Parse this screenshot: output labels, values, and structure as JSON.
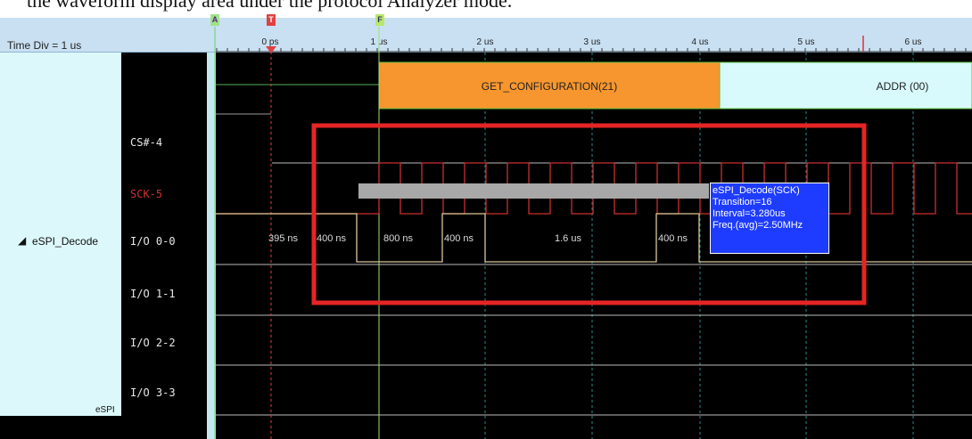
{
  "caption": "the waveform display area under the protocol Analyzer mode.",
  "header": {
    "time_div_label": "Time Div = 1 us",
    "ticks": [
      "0 ps",
      "1 us",
      "2 us",
      "3 us",
      "4 us",
      "5 us",
      "6 us"
    ]
  },
  "markers": {
    "a": "A",
    "t": "T",
    "f": "F"
  },
  "sidebar": {
    "group_name": "eSPI_Decode",
    "group_short": "eSPI"
  },
  "channels": [
    "CS#-4",
    "SCK-5",
    "I/O 0-0",
    "I/O 1-1",
    "I/O 2-2",
    "I/O 3-3"
  ],
  "packets": {
    "first": "GET_CONFIGURATION(21)",
    "second": "ADDR (00)"
  },
  "measurements": [
    "395 ns",
    "400 ns",
    "800 ns",
    "400 ns",
    "1.6 us",
    "400 ns"
  ],
  "tooltip": {
    "line1": "eSPI_Decode(SCK)",
    "line2": "Transition=16",
    "line3": "Interval=3.280us",
    "line4": "Freq.(avg)=2.50MHz"
  },
  "colors": {
    "packet_orange": "#f7962e",
    "packet_cyan": "#d8fafc",
    "sck_red": "#d43030",
    "highlight_box": "#e52525",
    "tooltip_blue": "#1e3cff"
  }
}
